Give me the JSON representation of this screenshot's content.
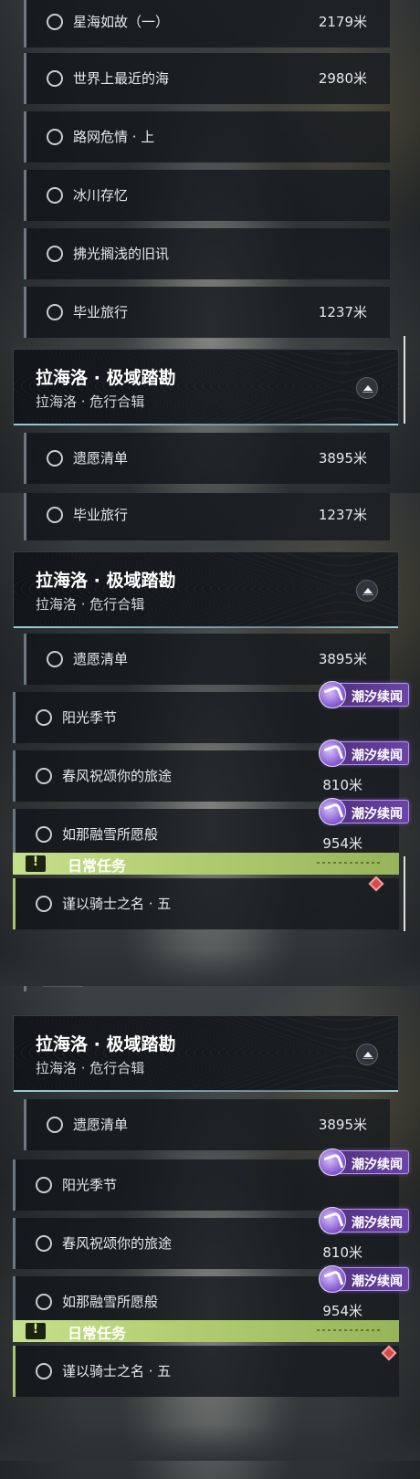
{
  "labels": {
    "collapse_icon": "chevron-up-icon",
    "tag_icon": "tide-story-icon",
    "daily_icon": "exclamation-icon"
  },
  "panel1": {
    "rows": [
      {
        "name": "星海如故（一）",
        "distance": "2179米"
      },
      {
        "name": "世界上最近的海",
        "distance": "2980米"
      },
      {
        "name": "路网危情 · 上",
        "distance": ""
      },
      {
        "name": "冰川存忆",
        "distance": ""
      },
      {
        "name": "拂光搁浅的旧讯",
        "distance": ""
      },
      {
        "name": "毕业旅行",
        "distance": "1237米"
      }
    ],
    "group": {
      "title": "拉海洛 · 极域踏勘",
      "subtitle": "拉海洛 · 危行合辑"
    },
    "after_group": {
      "name": "遗愿清单",
      "distance": "3895米"
    }
  },
  "panel2": {
    "top_row": {
      "name": "毕业旅行",
      "distance": "1237米"
    },
    "group": {
      "title": "拉海洛 · 极域踏勘",
      "subtitle": "拉海洛 · 危行合辑"
    },
    "sub_row": {
      "name": "遗愿清单",
      "distance": "3895米"
    },
    "story_rows": [
      {
        "name": "阳光季节",
        "distance": "",
        "tag": "潮汐续闻"
      },
      {
        "name": "春风祝颂你的旅途",
        "distance": "810米",
        "tag": "潮汐续闻"
      },
      {
        "name": "如那融雪所愿般",
        "distance": "954米",
        "tag": "潮汐续闻"
      }
    ],
    "daily": {
      "label": "日常任务",
      "task": "谨以骑士之名 · 五"
    }
  },
  "panel3": {
    "group": {
      "title": "拉海洛 · 极域踏勘",
      "subtitle": "拉海洛 · 危行合辑"
    },
    "sub_row": {
      "name": "遗愿清单",
      "distance": "3895米"
    },
    "story_rows": [
      {
        "name": "阳光季节",
        "distance": "",
        "tag": "潮汐续闻"
      },
      {
        "name": "春风祝颂你的旅途",
        "distance": "810米",
        "tag": "潮汐续闻"
      },
      {
        "name": "如那融雪所愿般",
        "distance": "954米",
        "tag": "潮汐续闻"
      }
    ],
    "daily": {
      "label": "日常任务",
      "task": "谨以骑士之名 · 五"
    }
  },
  "colors": {
    "accent_daily": "#b4cf73",
    "tag_purple": "#6b44a8",
    "marker_red": "#d84a4a",
    "group_underline": "#aadceb"
  }
}
